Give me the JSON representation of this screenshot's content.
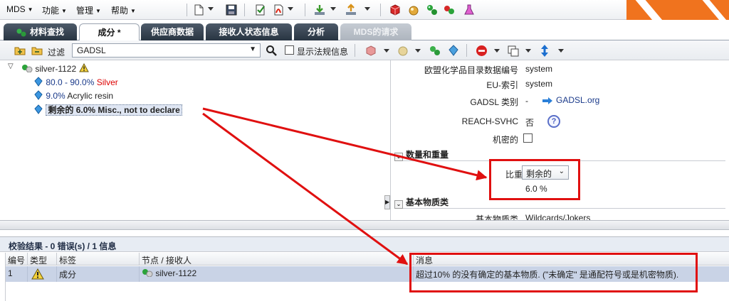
{
  "menus": [
    {
      "label": "MDS"
    },
    {
      "label": "功能"
    },
    {
      "label": "管理"
    },
    {
      "label": "帮助"
    }
  ],
  "tabs": [
    {
      "label": "材料查找"
    },
    {
      "label": "成分 *"
    },
    {
      "label": "供应商数据"
    },
    {
      "label": "接收人状态信息"
    },
    {
      "label": "分析"
    },
    {
      "label": "MDS的请求"
    }
  ],
  "filterbar": {
    "filter_label": "过滤",
    "filter_value": "GADSL",
    "show_regulations_label": "显示法规信息"
  },
  "tree": {
    "root_label": "silver-1122",
    "children": [
      {
        "percent": "80.0 - 90.0%",
        "name": "Silver"
      },
      {
        "percent": "9.0%",
        "name": "Acrylic resin"
      },
      {
        "prefix": "剩余的",
        "percent": "6.0%",
        "name": "Misc., not to declare"
      }
    ]
  },
  "detail": {
    "props": [
      {
        "label": "欧盟化学品目录数据编号",
        "value": "system"
      },
      {
        "label": "EU-索引",
        "value": "system"
      },
      {
        "label": "GADSL 类别",
        "value": "-",
        "link": "GADSL.org"
      },
      {
        "label": "REACH-SVHC",
        "value": "否"
      },
      {
        "label": "机密的",
        "value": ""
      }
    ],
    "section_weight": "数量和重量",
    "ratio_label": "比重",
    "ratio_select": "剩余的",
    "ratio_value": "6.0 %",
    "section_basic": "基本物质类",
    "basic_label": "基本物质类",
    "basic_value": "Wildcards/Jokers"
  },
  "results": {
    "title": "校验结果 - 0 错误(s) / 1 信息",
    "columns": [
      "编号",
      "类型",
      "标签",
      "节点 / 接收人",
      "消息"
    ],
    "rows": [
      {
        "no": "1",
        "type": "warning",
        "label": "成分",
        "node": "silver-1122",
        "message": "超过10% 的没有确定的基本物质. (\"未确定\" 是通配符号或是机密物质)."
      }
    ]
  },
  "colors": {
    "accent_orange": "#f0731e",
    "annotation_red": "#e01010",
    "tab_dark": "#2f3b49",
    "selection_row": "#c9d3e6"
  }
}
